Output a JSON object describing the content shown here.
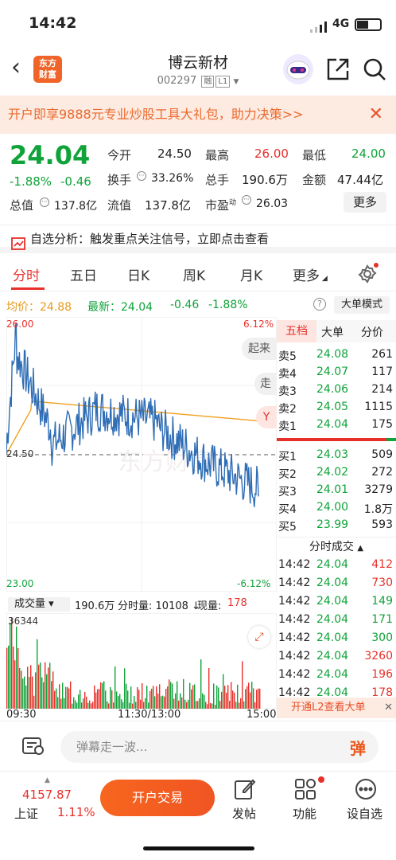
{
  "status": {
    "time": "14:42",
    "network": "4G"
  },
  "nav": {
    "title": "博云新材",
    "code": "002297",
    "tag1": "融",
    "tag2": "L1",
    "logo_line1": "东方",
    "logo_line2": "财富"
  },
  "promo": {
    "text": "开户即享9888元专业炒股工具大礼包，助力决策>>"
  },
  "quote": {
    "price": "24.04",
    "change_pct": "-1.88%",
    "change": "-0.46",
    "open_label": "今开",
    "open": "24.50",
    "high_label": "最高",
    "high": "26.00",
    "low_label": "最低",
    "low": "24.00",
    "turnover_label": "换手",
    "turnover": "33.26%",
    "volume_label": "总手",
    "volume": "190.6万",
    "amount_label": "金额",
    "amount": "47.44亿",
    "mktcap_label": "总值",
    "mktcap": "137.8亿",
    "float_label": "流值",
    "float": "137.8亿",
    "pe_label": "市盈",
    "pe_sup": "动",
    "pe": "26.03",
    "more": "更多"
  },
  "analysis": {
    "text": "自选分析：触发重点关注信号，立即点击查看"
  },
  "tabs": [
    "分时",
    "五日",
    "日K",
    "周K",
    "月K",
    "更多"
  ],
  "ma": {
    "avg_label": "均价：",
    "avg": "24.88",
    "latest_label": "最新：",
    "latest": "24.04",
    "chg": "-0.46",
    "pct": "-1.88%",
    "bigorder": "大单模式"
  },
  "chart": {
    "ymax": "26.00",
    "ymin": "23.00",
    "ymid": "24.50",
    "pct_max": "6.12%",
    "pct_min": "-6.12%",
    "btn_up": "起来",
    "btn_go": "走",
    "vol_max": "36344",
    "t_start": "09:30",
    "t_mid": "11:30/13:00",
    "t_end": "15:00",
    "watermark": "东方财富"
  },
  "volume_bar": {
    "label": "成交量",
    "total": "190.6万",
    "tick_label": "分时量:",
    "tick": "10108",
    "now_label": "现量:",
    "now": "178"
  },
  "orderbook": {
    "tabs": [
      "五档",
      "大单",
      "分价"
    ],
    "asks": [
      {
        "l": "卖5",
        "p": "24.08",
        "v": "261"
      },
      {
        "l": "卖4",
        "p": "24.07",
        "v": "117"
      },
      {
        "l": "卖3",
        "p": "24.06",
        "v": "214"
      },
      {
        "l": "卖2",
        "p": "24.05",
        "v": "1115"
      },
      {
        "l": "卖1",
        "p": "24.04",
        "v": "175"
      }
    ],
    "bids": [
      {
        "l": "买1",
        "p": "24.03",
        "v": "509"
      },
      {
        "l": "买2",
        "p": "24.02",
        "v": "272"
      },
      {
        "l": "买3",
        "p": "24.01",
        "v": "3279"
      },
      {
        "l": "买4",
        "p": "24.00",
        "v": "1.8万"
      },
      {
        "l": "买5",
        "p": "23.99",
        "v": "593"
      }
    ],
    "trades_title": "分时成交",
    "trades": [
      {
        "t": "14:42",
        "p": "24.04",
        "v": "412",
        "c": "red"
      },
      {
        "t": "14:42",
        "p": "24.04",
        "v": "730",
        "c": "red"
      },
      {
        "t": "14:42",
        "p": "24.04",
        "v": "149",
        "c": "green"
      },
      {
        "t": "14:42",
        "p": "24.04",
        "v": "171",
        "c": "green"
      },
      {
        "t": "14:42",
        "p": "24.04",
        "v": "300",
        "c": "green"
      },
      {
        "t": "14:42",
        "p": "24.04",
        "v": "3260",
        "c": "red"
      },
      {
        "t": "14:42",
        "p": "24.04",
        "v": "196",
        "c": "red"
      },
      {
        "t": "14:42",
        "p": "24.04",
        "v": "178",
        "c": "red"
      }
    ],
    "l2": "开通L2查看大单"
  },
  "comment": {
    "placeholder": "弹幕走一波...",
    "dan": "弹"
  },
  "dock": {
    "index": "4157.87",
    "index_name": "上证",
    "index_pct": "1.11%",
    "trade_btn": "开户交易",
    "post": "发帖",
    "func": "功能",
    "settings": "设自选"
  }
}
